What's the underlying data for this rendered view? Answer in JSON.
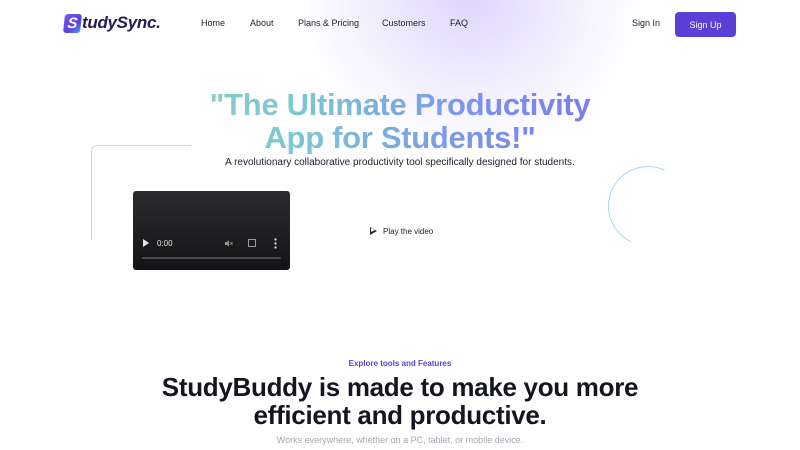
{
  "header": {
    "logo_letter": "S",
    "logo_text": "tudySync.",
    "nav": [
      {
        "label": "Home"
      },
      {
        "label": "About"
      },
      {
        "label": "Plans & Pricing"
      },
      {
        "label": "Customers"
      },
      {
        "label": "FAQ"
      }
    ],
    "sign_in": "Sign In",
    "sign_up": "Sign Up"
  },
  "hero": {
    "title_line1": "\"The Ultimate Productivity",
    "title_line2": "App for Students!\"",
    "subtitle": "A revolutionary collaborative productivity tool specifically designed for students.",
    "video": {
      "current_time": "0:00",
      "controls": [
        "play-icon",
        "mute-icon",
        "fullscreen-icon",
        "more-options-icon"
      ]
    },
    "play_video_label": "Play the video"
  },
  "features": {
    "eyebrow": "Explore tools and Features",
    "title_line1": "StudyBuddy is made to make you more",
    "title_line2": "efficient and productive.",
    "subtitle": "Works everywhere, whether on a PC, tablet, or mobile device."
  },
  "colors": {
    "brand": "#5b3fd8",
    "gradient_start": "#96dcb8",
    "gradient_end": "#7a56e6",
    "text_dark": "#14161f",
    "muted": "#a4a7b0"
  }
}
